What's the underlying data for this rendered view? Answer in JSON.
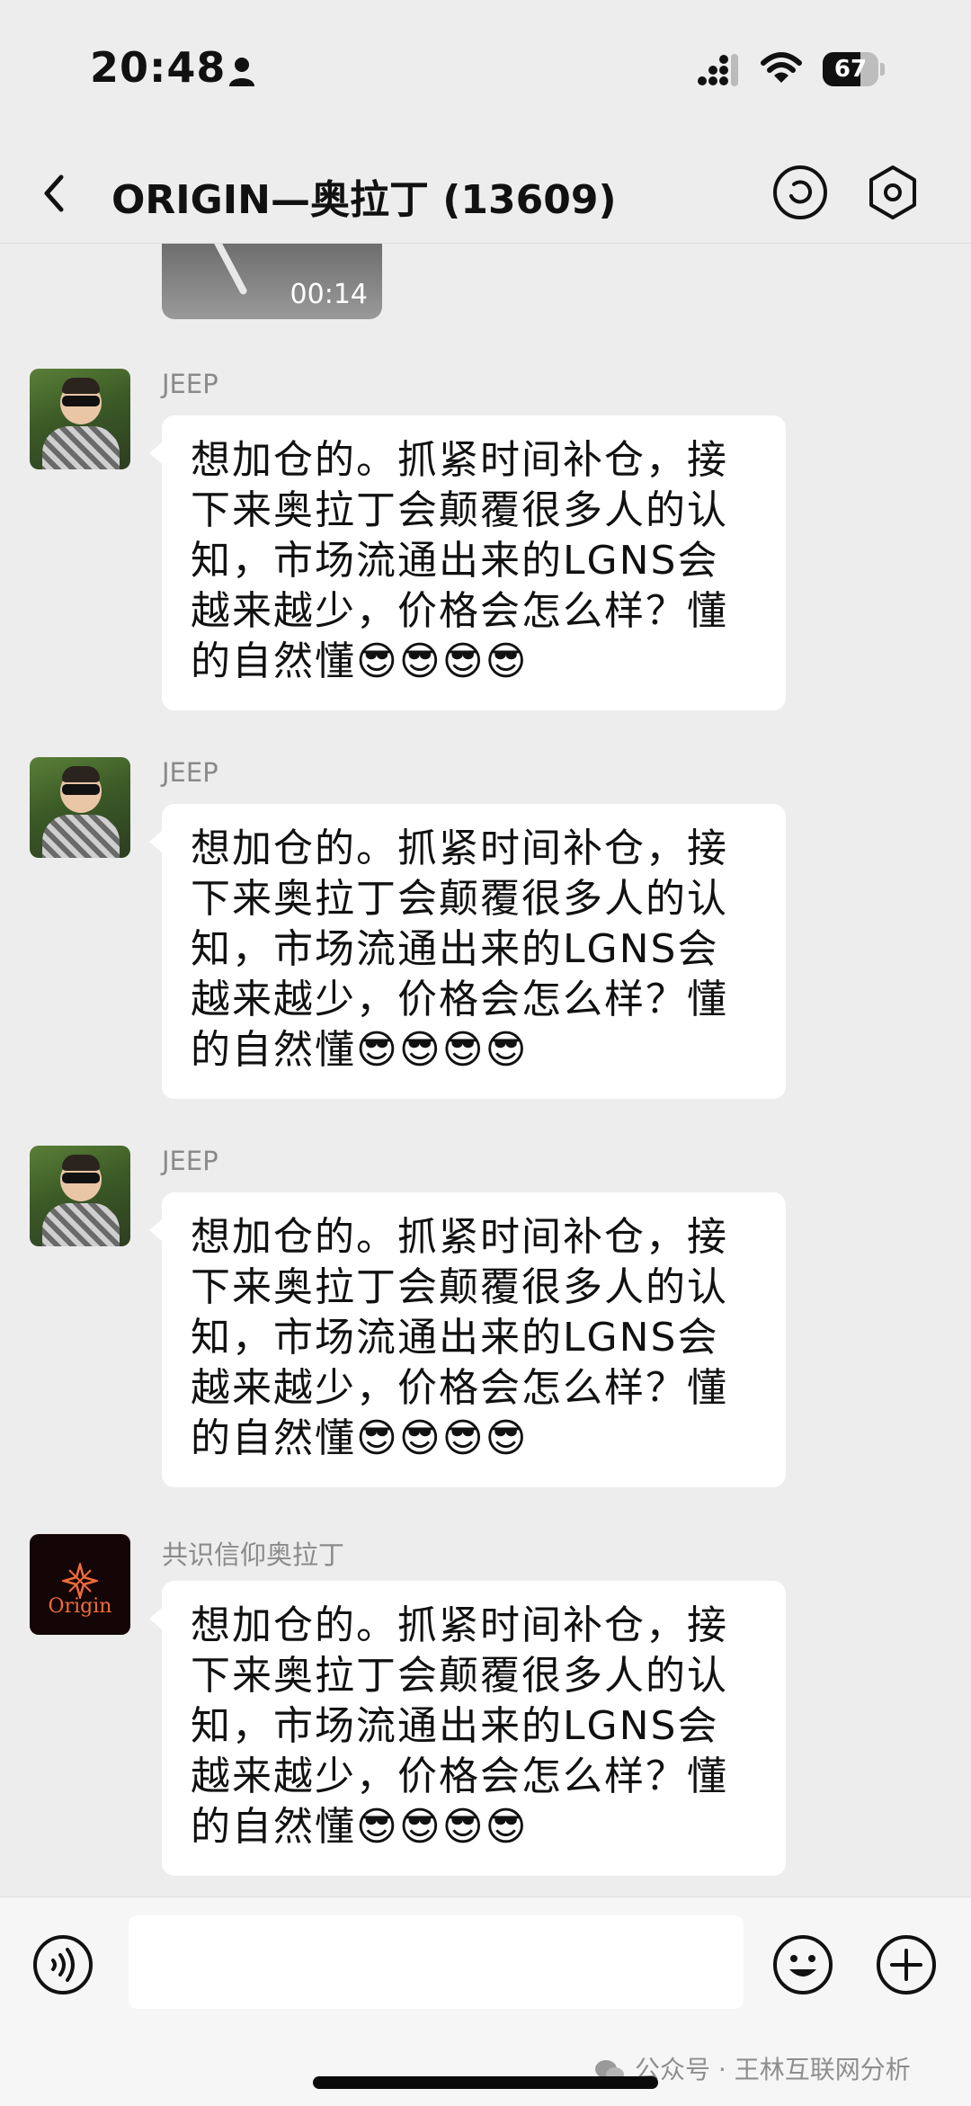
{
  "status_bar": {
    "time": "20:48",
    "battery_percent": "67",
    "battery_level": 0.67
  },
  "header": {
    "title": "ORIGIN—奥拉丁 (13609)"
  },
  "video_message": {
    "duration": "00:14"
  },
  "messages": [
    {
      "sender": "JEEP",
      "avatar": "photo",
      "text": "想加仓的。抓紧时间补仓，接下来奥拉丁会颠覆很多人的认知，市场流通出来的LGNS会越来越少，价格会怎么样？懂的自然懂😎😎😎😎"
    },
    {
      "sender": "JEEP",
      "avatar": "photo",
      "text": "想加仓的。抓紧时间补仓，接下来奥拉丁会颠覆很多人的认知，市场流通出来的LGNS会越来越少，价格会怎么样？懂的自然懂😎😎😎😎"
    },
    {
      "sender": "JEEP",
      "avatar": "photo",
      "text": "想加仓的。抓紧时间补仓，接下来奥拉丁会颠覆很多人的认知，市场流通出来的LGNS会越来越少，价格会怎么样？懂的自然懂😎😎😎😎"
    },
    {
      "sender": "共识信仰奥拉丁",
      "avatar": "logo",
      "avatar_logo_text": "Origin",
      "text": "想加仓的。抓紧时间补仓，接下来奥拉丁会颠覆很多人的认知，市场流通出来的LGNS会越来越少，价格会怎么样？懂的自然懂😎😎😎😎"
    }
  ],
  "input_bar": {
    "value": "",
    "placeholder": ""
  },
  "watermark": {
    "text": "公众号 · 王林互联网分析"
  },
  "icons": {
    "back": "chevron-left-icon",
    "pay": "circle-refresh-icon",
    "more": "hexagon-settings-icon",
    "voice": "voice-icon",
    "emoji": "smile-icon",
    "plus": "plus-icon"
  }
}
